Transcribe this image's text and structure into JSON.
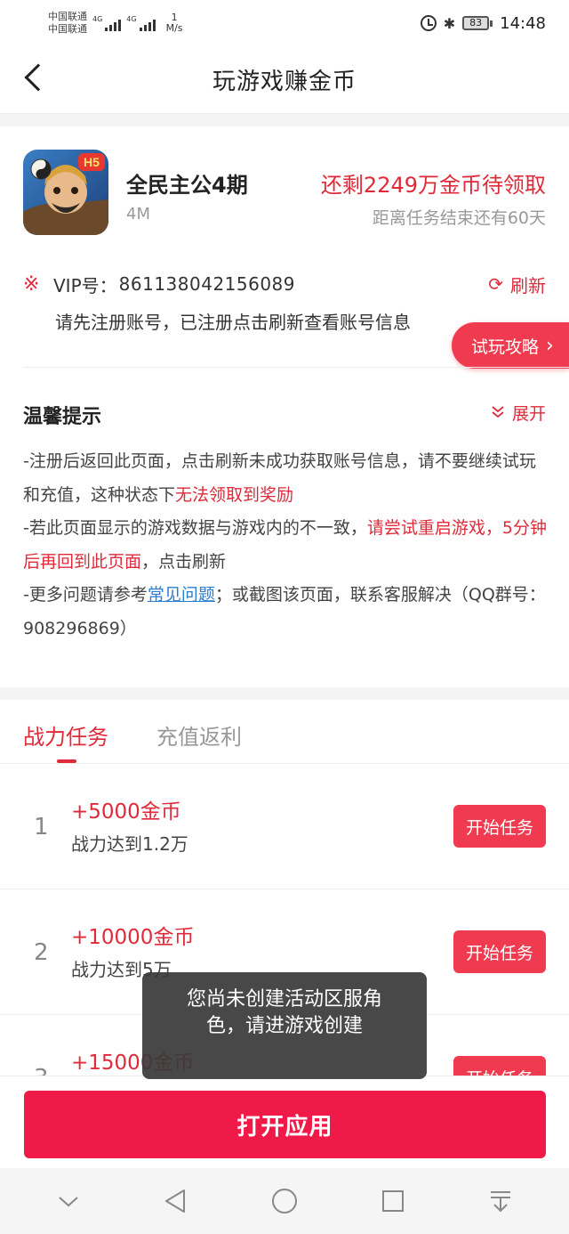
{
  "status_bar": {
    "carrier_1": "中国联通",
    "carrier_2": "中国联通",
    "net_1": "4G",
    "net_2": "4G",
    "speed_value": "1",
    "speed_unit": "M/s",
    "battery": "83",
    "time": "14:48"
  },
  "header": {
    "title": "玩游戏赚金币"
  },
  "game": {
    "icon_badge": "H5",
    "name": "全民主公4期",
    "size": "4M",
    "reward_remaining": "还剩2249万金币待领取",
    "deadline": "距离任务结束还有60天"
  },
  "vip": {
    "marker": "※",
    "label": "VIP号：",
    "number": "861138042156089",
    "refresh_label": "刷新",
    "hint": "请先注册账号，已注册点击刷新查看账号信息"
  },
  "guide_button": {
    "label": "试玩攻略"
  },
  "tips": {
    "title": "温馨提示",
    "expand_label": "展开",
    "line1_a": "-注册后返回此页面，点击刷新未成功获取账号信息，请不要继续试玩和充值，这种状态下",
    "line1_red": "无法领取到奖励",
    "line2_a": "-若此页面显示的游戏数据与游戏内的不一致，",
    "line2_red": "请尝试重启游戏，5分钟后再回到此页面",
    "line2_b": "，点击刷新",
    "line3_a": "-更多问题请参考",
    "line3_link": "常见问题",
    "line3_b": "；或截图该页面，联系客服解决（QQ群号：908296869）"
  },
  "tabs": [
    {
      "label": "战力任务",
      "active": true
    },
    {
      "label": "充值返利",
      "active": false
    }
  ],
  "tasks": [
    {
      "index": "1",
      "reward": "+5000金币",
      "condition": "战力达到1.2万",
      "button": "开始任务"
    },
    {
      "index": "2",
      "reward": "+10000金币",
      "condition": "战力达到5万",
      "button": "开始任务"
    },
    {
      "index": "3",
      "reward": "+15000金币",
      "condition": "",
      "button": "开始任务"
    }
  ],
  "toast": {
    "message": "您尚未创建活动区服角色，请进游戏创建"
  },
  "bottom": {
    "open_button": "打开应用"
  },
  "icons": {
    "back": "chevron-left-icon",
    "refresh": "refresh-icon",
    "expand": "double-chevron-down-icon",
    "nav": [
      "chevron-down-icon",
      "back-triangle-icon",
      "home-circle-icon",
      "recents-square-icon",
      "notification-pull-icon"
    ]
  },
  "colors": {
    "accent": "#e02a3a",
    "button": "#f03a4f",
    "primary_button": "#f01a48",
    "link": "#2b7cd3"
  }
}
